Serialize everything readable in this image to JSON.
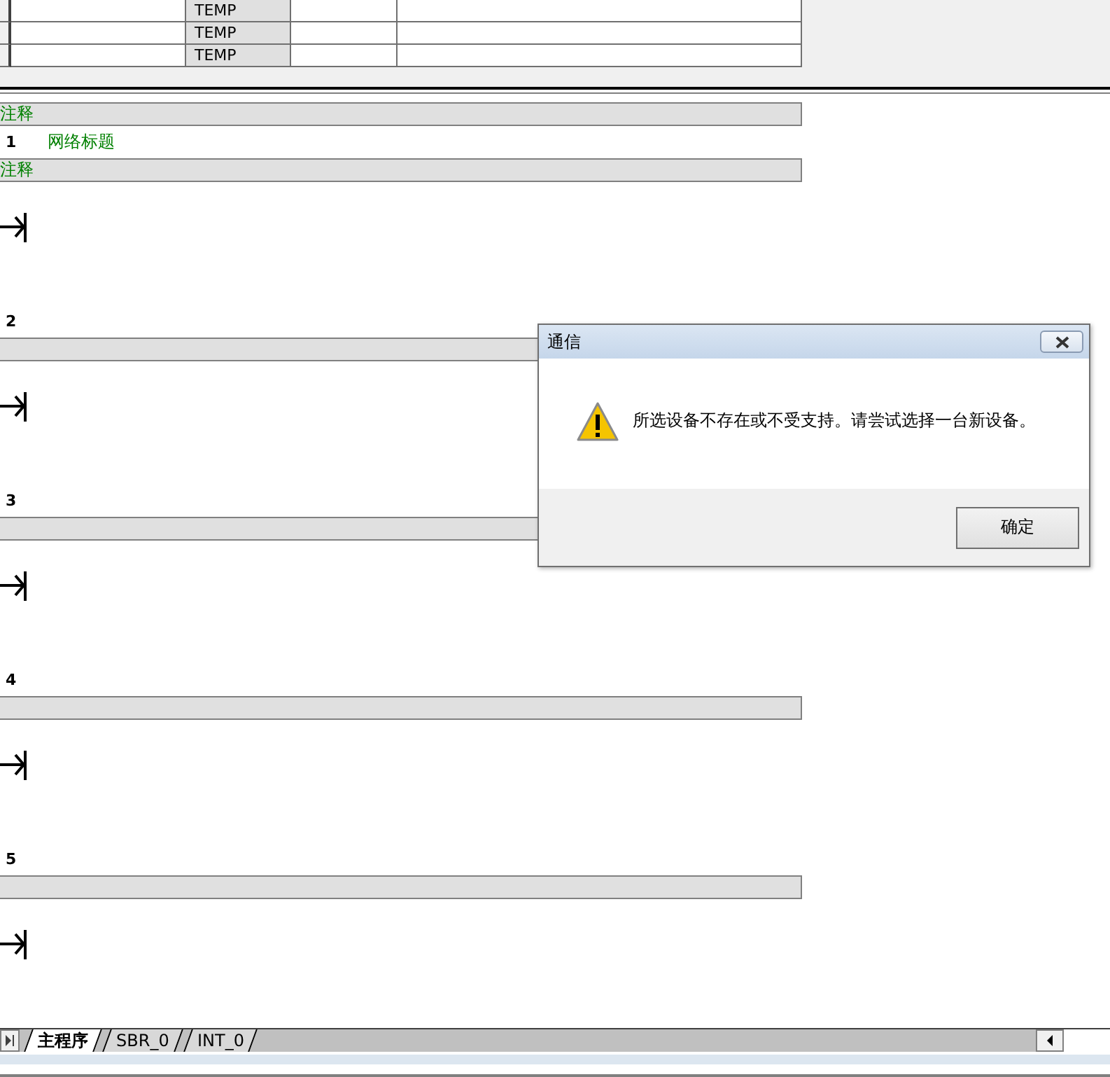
{
  "variable_table": {
    "rows": [
      {
        "type": "TEMP"
      },
      {
        "type": "TEMP"
      },
      {
        "type": "TEMP"
      }
    ]
  },
  "program_comment": "注释",
  "networks": [
    {
      "number": "1",
      "title": "网络标题",
      "comment": "注释"
    },
    {
      "number": "2"
    },
    {
      "number": "3"
    },
    {
      "number": "4"
    },
    {
      "number": "5"
    }
  ],
  "tabs": [
    {
      "label": "主程序",
      "selected": true
    },
    {
      "label": "SBR_0",
      "selected": false
    },
    {
      "label": "INT_0",
      "selected": false
    }
  ],
  "dialog": {
    "title": "通信",
    "message": "所选设备不存在或不受支持。请尝试选择一台新设备。",
    "buttons": [
      "确定"
    ]
  }
}
